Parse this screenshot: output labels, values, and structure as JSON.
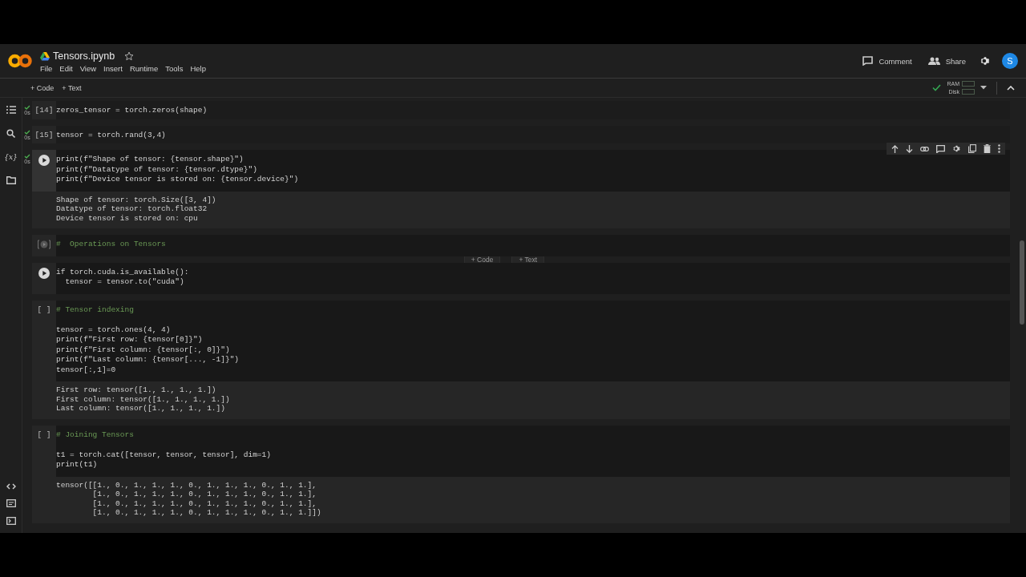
{
  "header": {
    "title": "Tensors.ipynb",
    "starred": false,
    "menu": [
      "File",
      "Edit",
      "View",
      "Insert",
      "Runtime",
      "Tools",
      "Help"
    ],
    "comment_button": "Comment",
    "share_button": "Share",
    "avatar": "S"
  },
  "toolbar": {
    "add_code": "+ Code",
    "add_text": "+ Text",
    "ram_label": "RAM",
    "disk_label": "Disk",
    "connected": true
  },
  "sidebar": {
    "variables_icon": "{x}"
  },
  "cells": [
    {
      "kind": "counted_code",
      "prompt": "[14]",
      "status": "0s",
      "selected": false,
      "lines": [
        "zeros_tensor = torch.zeros(shape)"
      ]
    },
    {
      "kind": "counted_code",
      "prompt": "[15]",
      "status": "0s",
      "selected": false,
      "lines": [
        "tensor = torch.rand(3,4)"
      ]
    },
    {
      "kind": "runnable_code",
      "status": "0s",
      "selected": true,
      "lines": [
        "print(f\"Shape of tensor: {tensor.shape}\")",
        "print(f\"Datatype of tensor: {tensor.dtype}\")",
        "print(f\"Device tensor is stored on: {tensor.device}\")"
      ],
      "output": [
        "Shape of tensor: torch.Size([3, 4])",
        "Datatype of tensor: torch.float32",
        "Device tensor is stored on: cpu"
      ]
    },
    {
      "kind": "dimmed_code",
      "selected": false,
      "comment": "#  Operations on Tensors"
    },
    {
      "kind": "insert_bar",
      "buttons": [
        "+ Code",
        "+ Text"
      ]
    },
    {
      "kind": "runnable_code",
      "selected": false,
      "lines": [
        "if torch.cuda.is_available():",
        "  tensor = tensor.to(\"cuda\")"
      ]
    },
    {
      "kind": "counted_code",
      "prompt": "[ ]",
      "selected": false,
      "comment": "# Tensor indexing",
      "lines": [
        "tensor = torch.ones(4, 4)",
        "print(f\"First row: {tensor[0]}\")",
        "print(f\"First column: {tensor[:, 0]}\")",
        "print(f\"Last column: {tensor[..., -1]}\")",
        "tensor[:,1]=0"
      ],
      "output": [
        "First row: tensor([1., 1., 1., 1.])",
        "First column: tensor([1., 1., 1., 1.])",
        "Last column: tensor([1., 1., 1., 1.])"
      ]
    },
    {
      "kind": "counted_code",
      "prompt": "[ ]",
      "selected": false,
      "comment": "# Joining Tensors",
      "lines": [
        "t1 = torch.cat([tensor, tensor, tensor], dim=1)",
        "print(t1)"
      ],
      "output": [
        "tensor([[1., 0., 1., 1., 1., 0., 1., 1., 1., 0., 1., 1.],",
        "        [1., 0., 1., 1., 1., 0., 1., 1., 1., 0., 1., 1.],",
        "        [1., 0., 1., 1., 1., 0., 1., 1., 1., 0., 1., 1.],",
        "        [1., 0., 1., 1., 1., 0., 1., 1., 1., 0., 1., 1.]])"
      ]
    }
  ]
}
